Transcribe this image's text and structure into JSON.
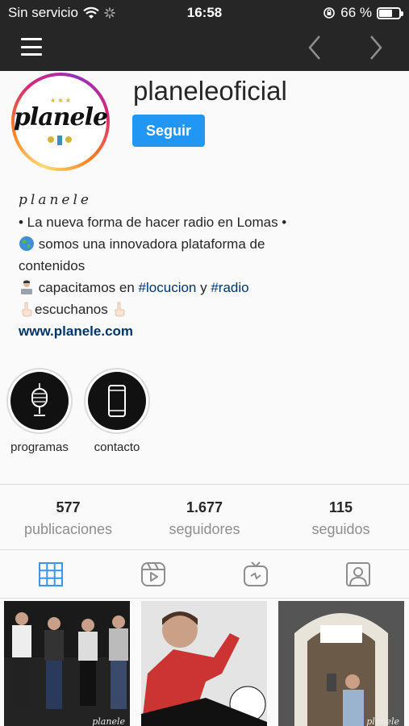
{
  "status_bar": {
    "carrier": "Sin servicio",
    "time": "16:58",
    "battery_percent": "66 %",
    "battery_level": 0.66
  },
  "nav": {
    "menu_icon": "hamburger-icon",
    "back_icon": "chevron-left-icon",
    "forward_icon": "chevron-right-icon"
  },
  "profile": {
    "username": "planeleoficial",
    "follow_label": "Seguir",
    "avatar_text": "planele"
  },
  "bio": {
    "name": "planele",
    "line1": "• La nueva forma de hacer radio en Lomas •",
    "line2": "somos una innovadora plataforma de",
    "line3": "contenidos",
    "line4_pre": "capacitamos en",
    "tag1": "#locucion",
    "line4_mid": "y",
    "tag2": "#radio",
    "line5": "escuchanos",
    "website": "www.planele.com"
  },
  "highlights": [
    {
      "label": "programas",
      "icon": "microphone-icon"
    },
    {
      "label": "contacto",
      "icon": "phone-icon"
    }
  ],
  "stats": [
    {
      "value": "577",
      "label": "publicaciones"
    },
    {
      "value": "1.677",
      "label": "seguidores"
    },
    {
      "value": "115",
      "label": "seguidos"
    }
  ],
  "tabs": [
    {
      "name": "grid",
      "icon": "grid-icon",
      "active": true
    },
    {
      "name": "reels",
      "icon": "reels-icon",
      "active": false
    },
    {
      "name": "igtv",
      "icon": "igtv-icon",
      "active": false
    },
    {
      "name": "tagged",
      "icon": "tagged-icon",
      "active": false
    }
  ],
  "posts": [
    {
      "watermark": "planele"
    },
    {
      "watermark": ""
    },
    {
      "watermark": "planele"
    }
  ],
  "colors": {
    "accent": "#2196f3",
    "bar": "#262626",
    "link": "#003569",
    "active_tab": "#3897f0"
  }
}
